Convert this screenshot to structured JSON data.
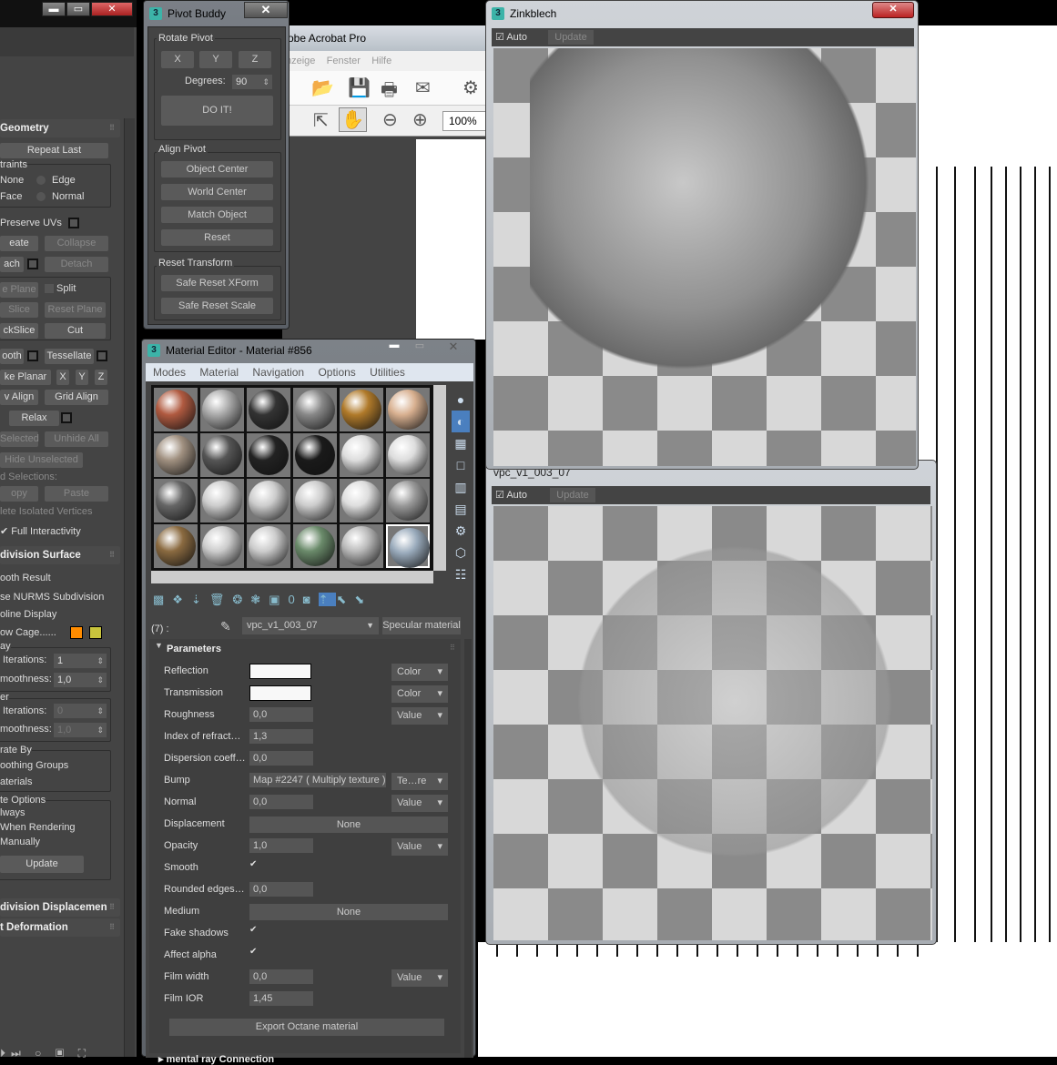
{
  "left_panel": {
    "window_buttons": [
      "▬",
      "▭",
      "✕"
    ],
    "geometry": {
      "title": "Geometry",
      "repeat_last": "Repeat Last",
      "constraints_label": "traints",
      "constraints": [
        "None",
        "Edge",
        "Face",
        "Normal"
      ],
      "preserve_uvs": "Preserve UVs",
      "create": "eate",
      "collapse": "Collapse",
      "attach": "ach",
      "detach": "Detach",
      "slice_plane": "e Plane",
      "split": "Split",
      "slice": "Slice",
      "reset_plane": "Reset Plane",
      "quickslice": "ckSlice",
      "cut": "Cut",
      "msmooth": "ooth",
      "tessellate": "Tessellate",
      "make_planar": "ke Planar",
      "x": "X",
      "y": "Y",
      "z": "Z",
      "view_align": "v Align",
      "grid_align": "Grid Align",
      "relax": "Relax",
      "hide_selected": "Selected",
      "unhide_all": "Unhide All",
      "hide_unselected": "Hide Unselected",
      "named_selections": "d Selections:",
      "copy": "opy",
      "paste": "Paste",
      "delete_isolated": "lete Isolated Vertices",
      "full_interactivity": "Full Interactivity"
    },
    "subdivision": {
      "title": "division Surface",
      "smooth_result": "ooth Result",
      "use_nurms": "se NURMS Subdivision",
      "isoline": "oline Display",
      "show_cage": "ow Cage......",
      "cage_colors": [
        "#ff8c00",
        "#c8c43c"
      ],
      "display_label": "ay",
      "iterations_label": "Iterations:",
      "iterations_value": "1",
      "smoothness_label": "moothness:",
      "smoothness_value": "1,0",
      "render_label": "er",
      "render_iterations_value": "0",
      "render_smoothness_value": "1,0",
      "separate_by": "rate By",
      "smoothing_groups": "oothing Groups",
      "materials": "aterials",
      "update_options": "te Options",
      "always": "lways",
      "when_rendering": "When Rendering",
      "manually": "Manually",
      "update": "Update"
    },
    "rollout_displacement": "division Displacemen",
    "rollout_deformation": "t Deformation"
  },
  "acrobat": {
    "title": "obe Acrobat Pro",
    "menu": [
      "nzeige",
      "Fenster",
      "Hilfe"
    ],
    "zoom": "100%"
  },
  "pivot_buddy": {
    "title": "Pivot Buddy",
    "close": "✕",
    "rotate_pivot": "Rotate Pivot",
    "axes": [
      "X",
      "Y",
      "Z"
    ],
    "degrees_label": "Degrees:",
    "degrees_value": "90",
    "do_it": "DO IT!",
    "align_pivot": "Align Pivot",
    "align_buttons": [
      "Object Center",
      "World Center",
      "Match Object",
      "Reset"
    ],
    "reset_transform": "Reset Transform",
    "reset_buttons": [
      "Safe Reset XForm",
      "Safe Reset Scale"
    ]
  },
  "material_editor": {
    "title": "Material Editor - Material #856",
    "menu": [
      "Modes",
      "Material",
      "Navigation",
      "Options",
      "Utilities"
    ],
    "slot_colors": [
      [
        "#b05a40",
        "#aaa",
        "#333",
        "#888",
        "#b07a2a",
        "#d8b090"
      ],
      [
        "#a09080",
        "#555",
        "#222",
        "#1a1a1a",
        "#ddd",
        "#ddd"
      ],
      [
        "#666",
        "#ccc",
        "#ccc",
        "#ccc",
        "#ddd",
        "#999"
      ],
      [
        "#8a6a40",
        "#ccc",
        "#ccc",
        "#6a8a6a",
        "#bbb",
        "#9ab"
      ]
    ],
    "slot_label": "(7) :",
    "material_name": "vpc_v1_003_07",
    "material_type": "Specular material",
    "parameters_title": "Parameters",
    "params": [
      {
        "label": "Reflection",
        "kind": "color",
        "dd": "Color"
      },
      {
        "label": "Transmission",
        "kind": "color",
        "dd": "Color"
      },
      {
        "label": "Roughness",
        "kind": "spin",
        "value": "0,0",
        "dd": "Value"
      },
      {
        "label": "Index of refract…",
        "kind": "spin",
        "value": "1,3"
      },
      {
        "label": "Dispersion coeff…",
        "kind": "spin",
        "value": "0,0"
      },
      {
        "label": "Bump",
        "kind": "map",
        "value": "Map #2247  ( Multiply texture )",
        "dd": "Te…re"
      },
      {
        "label": "Normal",
        "kind": "spin",
        "value": "0,0",
        "dd": "Value"
      },
      {
        "label": "Displacement",
        "kind": "wide",
        "value": "None"
      },
      {
        "label": "Opacity",
        "kind": "spin",
        "value": "1,0",
        "dd": "Value"
      },
      {
        "label": "Smooth",
        "kind": "check",
        "value": "✔"
      },
      {
        "label": "Rounded edges…",
        "kind": "spin",
        "value": "0,0"
      },
      {
        "label": "Medium",
        "kind": "wide",
        "value": "None"
      },
      {
        "label": "Fake shadows",
        "kind": "check",
        "value": "✔"
      },
      {
        "label": "Affect alpha",
        "kind": "check",
        "value": "✔"
      },
      {
        "label": "Film width",
        "kind": "spin",
        "value": "0,0",
        "dd": "Value"
      },
      {
        "label": "Film IOR",
        "kind": "spin",
        "value": "1,45"
      }
    ],
    "export_button": "Export Octane material",
    "next_rollout": "mental ray Connection"
  },
  "render_top": {
    "title": "Zinkblech",
    "close": "✕",
    "auto": "Auto",
    "update": "Update"
  },
  "render_bottom": {
    "title": "vpc_v1_003_07",
    "auto": "Auto",
    "update": "Update"
  }
}
